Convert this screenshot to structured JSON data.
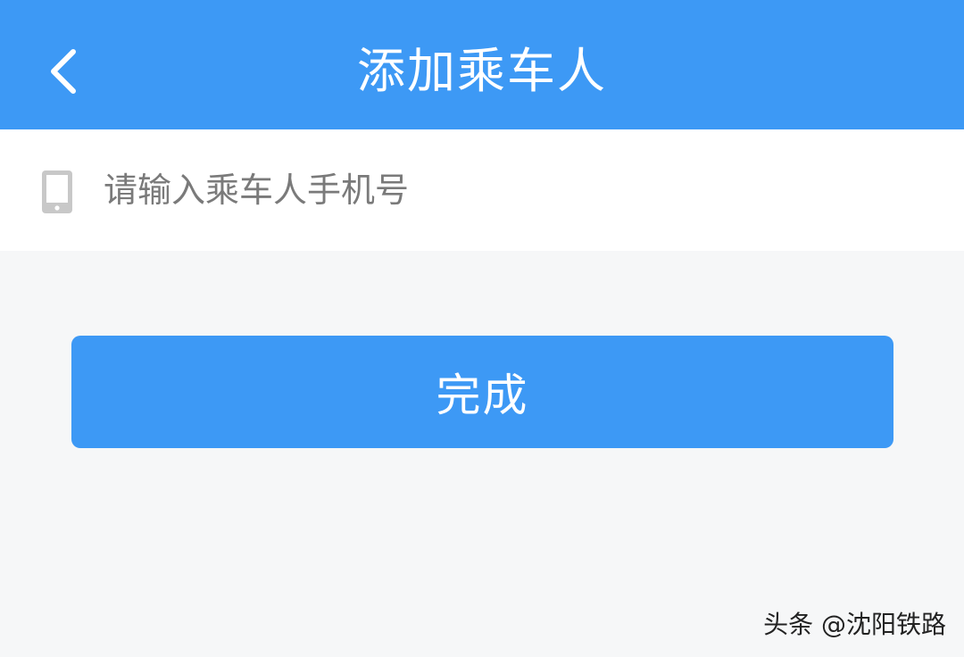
{
  "header": {
    "title": "添加乘车人",
    "back_icon": "chevron-left-icon"
  },
  "phone_field": {
    "icon": "mobile-phone-icon",
    "placeholder": "请输入乘车人手机号",
    "value": ""
  },
  "actions": {
    "done_label": "完成"
  },
  "watermark": {
    "text": "头条 @沈阳铁路"
  },
  "colors": {
    "accent": "#3d99f5",
    "background": "#f6f7f8",
    "surface": "#ffffff",
    "placeholder": "#7a7a7a",
    "icon_gray": "#c8c8c8"
  }
}
